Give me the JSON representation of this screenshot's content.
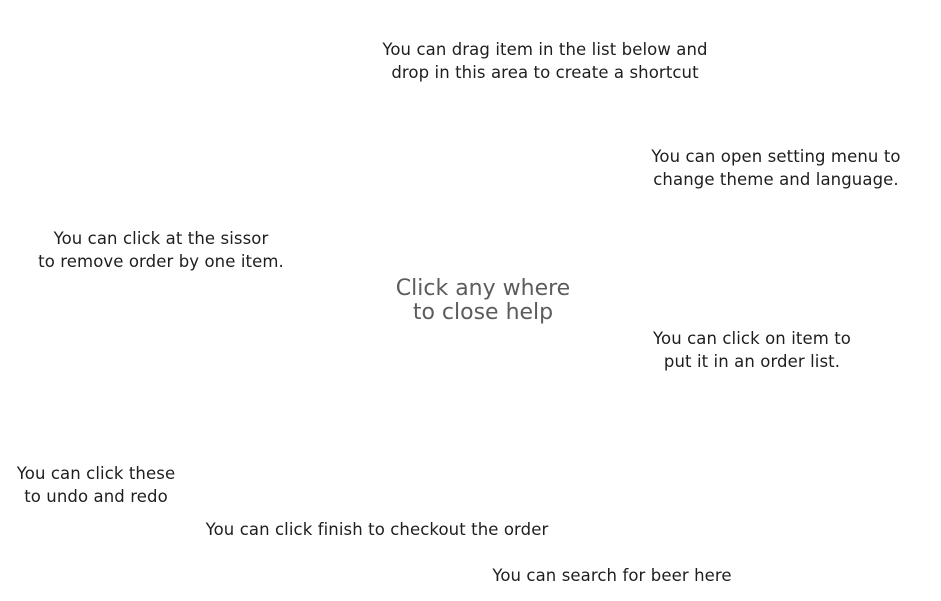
{
  "help": {
    "shortcut_tip": {
      "line1": "You can drag item in the list below and",
      "line2": "drop in this area to create a shortcut"
    },
    "settings_tip": {
      "line1": "You can open setting menu to",
      "line2": "change theme and language."
    },
    "scissor_tip": {
      "line1": "You can click at the sissor",
      "line2": "to remove order by one item."
    },
    "close_help": {
      "line1": "Click any where",
      "line2": "to close help"
    },
    "item_tip": {
      "line1": "You can click on item to",
      "line2": "put it in an order list."
    },
    "undo_redo_tip": {
      "line1": "You can click these",
      "line2": "to undo and redo"
    },
    "finish_tip": "You can click finish to checkout the order",
    "search_tip": "You can search for beer here"
  }
}
